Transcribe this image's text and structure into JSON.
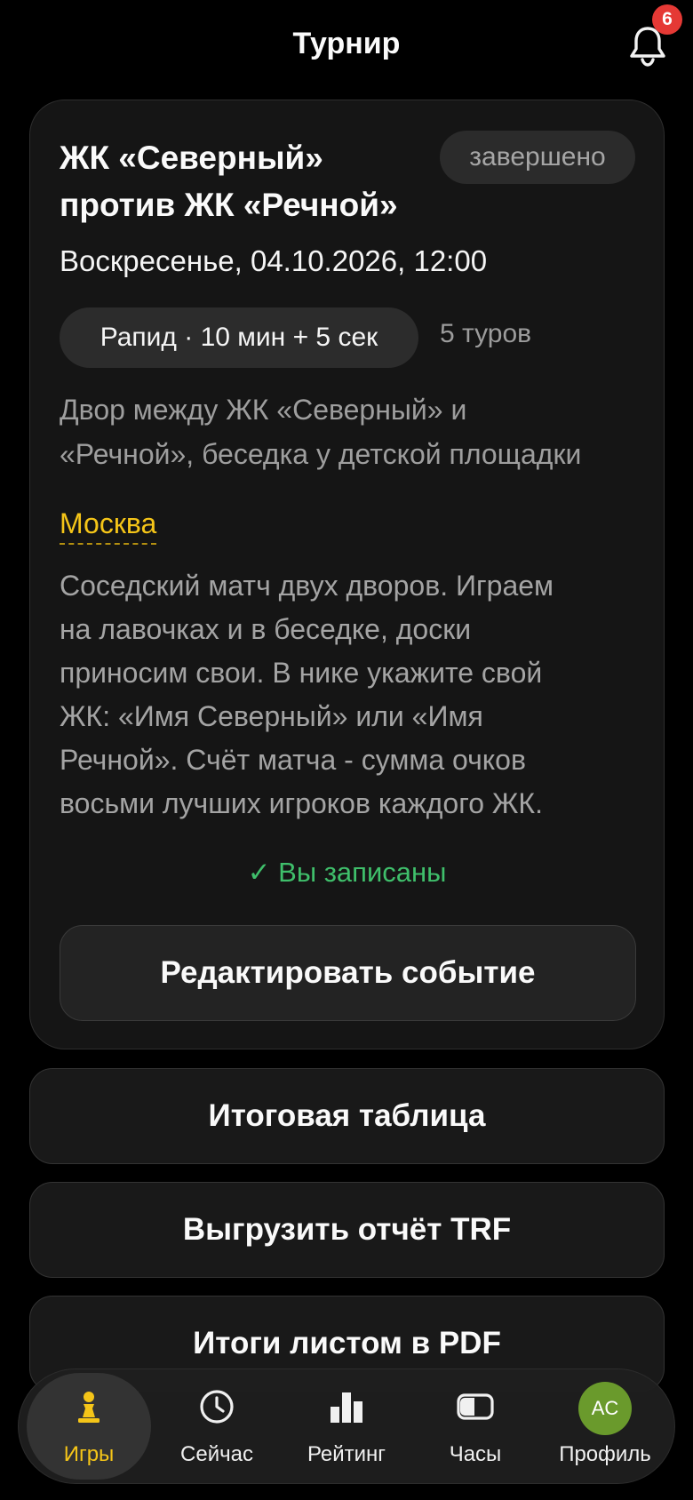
{
  "header": {
    "title": "Турнир",
    "notifications_count": "6"
  },
  "event": {
    "title_line1": "ЖК «Северный»",
    "title_line2": "против ЖК «Речной»",
    "status": "завершено",
    "datetime": "Воскресенье, 04.10.2026, 12:00",
    "format": "Рапид · 10 мин + 5 сек",
    "rounds": "5 туров",
    "venue_line1": "Двор между ЖК «Северный» и",
    "venue_line2": "«Речной», беседка у детской площадки",
    "city": "Москва",
    "description_lines": [
      "Соседский матч двух дворов. Играем",
      "на лавочках и в беседке, доски",
      "приносим свои. В нике укажите свой",
      "ЖК: «Имя Северный» или «Имя",
      "Речной». Счёт матча - сумма очков",
      "восьми лучших игроков каждого ЖК."
    ],
    "registered": "✓ Вы записаны",
    "edit_button": "Редактировать событие"
  },
  "actions": {
    "standings": "Итоговая таблица",
    "export_trf": "Выгрузить отчёт TRF",
    "pdf": "Итоги листом в PDF"
  },
  "tabbar": {
    "tabs": [
      {
        "label": "Игры",
        "icon": "chess-pawn-icon",
        "active": true
      },
      {
        "label": "Сейчас",
        "icon": "clock-icon",
        "active": false
      },
      {
        "label": "Рейтинг",
        "icon": "bar-chart-icon",
        "active": false
      },
      {
        "label": "Часы",
        "icon": "chess-clock-icon",
        "active": false
      },
      {
        "label": "Профиль",
        "icon": "avatar",
        "active": false,
        "avatar_initials": "AC"
      }
    ]
  },
  "colors": {
    "accent": "#f5c518",
    "success": "#3fbf6b",
    "badge": "#e53935",
    "avatar": "#6a9a2c"
  }
}
